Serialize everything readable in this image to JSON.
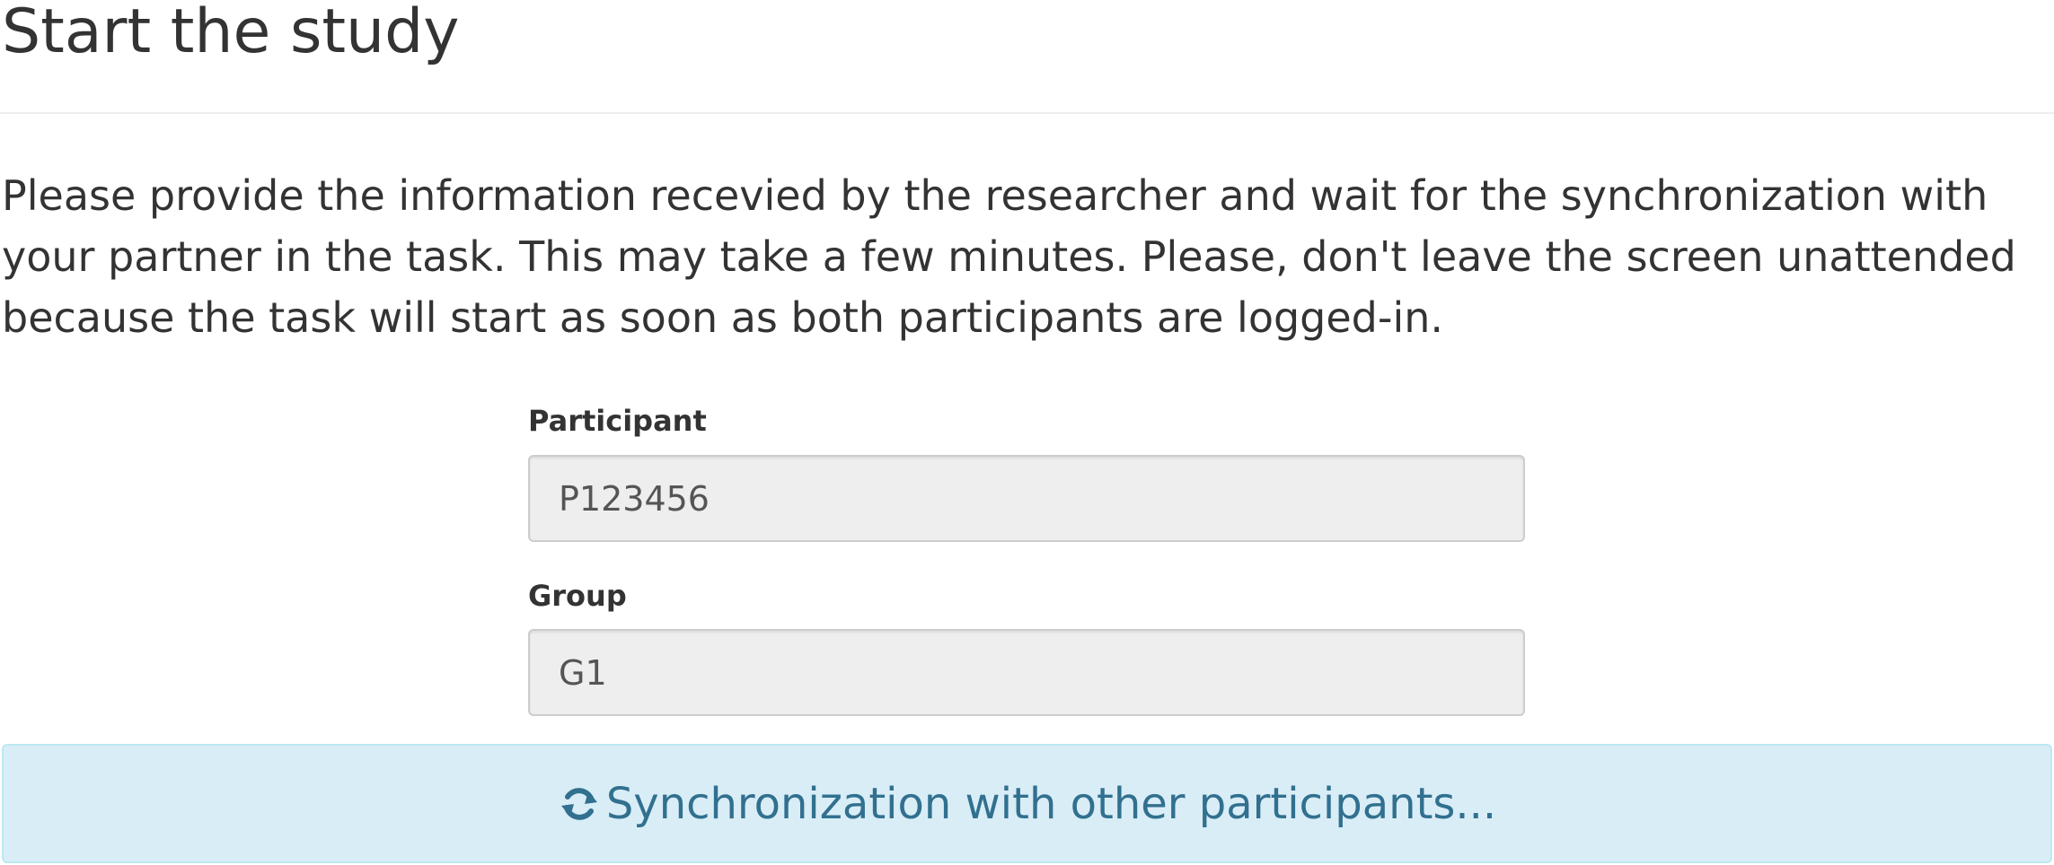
{
  "page": {
    "title": "Start the study",
    "instructions": "Please provide the information recevied by the researcher and wait for the synchronization with your partner in the task. This may take a few minutes. Please, don't leave the screen unattended because the task will start as soon as both participants are logged-in."
  },
  "form": {
    "participant": {
      "label": "Participant",
      "value": "P123456"
    },
    "group": {
      "label": "Group",
      "value": "G1"
    }
  },
  "status": {
    "icon": "refresh-icon",
    "message": "Synchronization with other participants...",
    "background_color": "#d9edf7",
    "text_color": "#31708f"
  }
}
